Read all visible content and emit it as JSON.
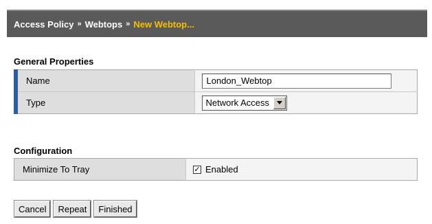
{
  "breadcrumb": {
    "items": [
      "Access Policy",
      "Webtops"
    ],
    "current": "New Webtop...",
    "separator": "»"
  },
  "general": {
    "title": "General Properties",
    "name_label": "Name",
    "name_value": "London_Webtop",
    "type_label": "Type",
    "type_value": "Network Access"
  },
  "configuration": {
    "title": "Configuration",
    "minimize_label": "Minimize To Tray",
    "minimize_checked": true,
    "enabled_label": "Enabled"
  },
  "buttons": {
    "cancel": "Cancel",
    "repeat": "Repeat",
    "finished": "Finished"
  },
  "colors": {
    "header_bg": "#5a5a5a",
    "current_crumb": "#f5c000",
    "required_marker": "#2e5e9a"
  }
}
